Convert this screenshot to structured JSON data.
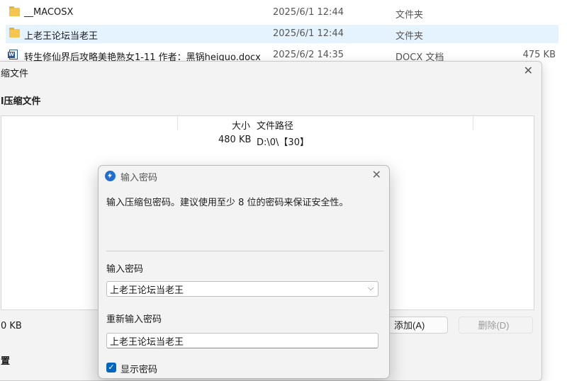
{
  "files": [
    {
      "name": "__MACOSX",
      "date": "2025/6/1 12:44",
      "type": "文件夹",
      "size": "",
      "icon": "folder-icon"
    },
    {
      "name": "上老王论坛当老王",
      "date": "2025/6/1 12:44",
      "type": "文件夹",
      "size": "",
      "icon": "folder-icon"
    },
    {
      "name": "转生修仙界后攻略美艳熟女1-11 作者：黑锅heiguo.docx",
      "date": "2025/6/2 14:35",
      "type": "DOCX 文档",
      "size": "475 KB",
      "icon": "word-doc-icon"
    }
  ],
  "compress_dialog": {
    "title": "缩文件",
    "close": "✕",
    "heading": "l压缩文件",
    "columns": {
      "size": "大小",
      "path": "文件路径"
    },
    "row": {
      "size": "480 KB",
      "path": "D:\\0\\【30】"
    },
    "total": "0 KB",
    "add_button": "添加(A)",
    "delete_button": "删除(D)",
    "section2": "置"
  },
  "password_dialog": {
    "title": "输入密码",
    "close": "✕",
    "description": "输入压缩包密码。建议使用至少 8 位的密码来保证安全性。",
    "password_label": "输入密码",
    "password_value": "上老王论坛当老王",
    "confirm_label": "重新输入密码",
    "confirm_value": "上老王论坛当老王",
    "show_password_label": "显示密码",
    "show_password_checked": true,
    "chevron": "⌵"
  },
  "colors": {
    "accent": "#0067c0",
    "selection": "#e5f3ff",
    "folder": "#f4c64d"
  }
}
